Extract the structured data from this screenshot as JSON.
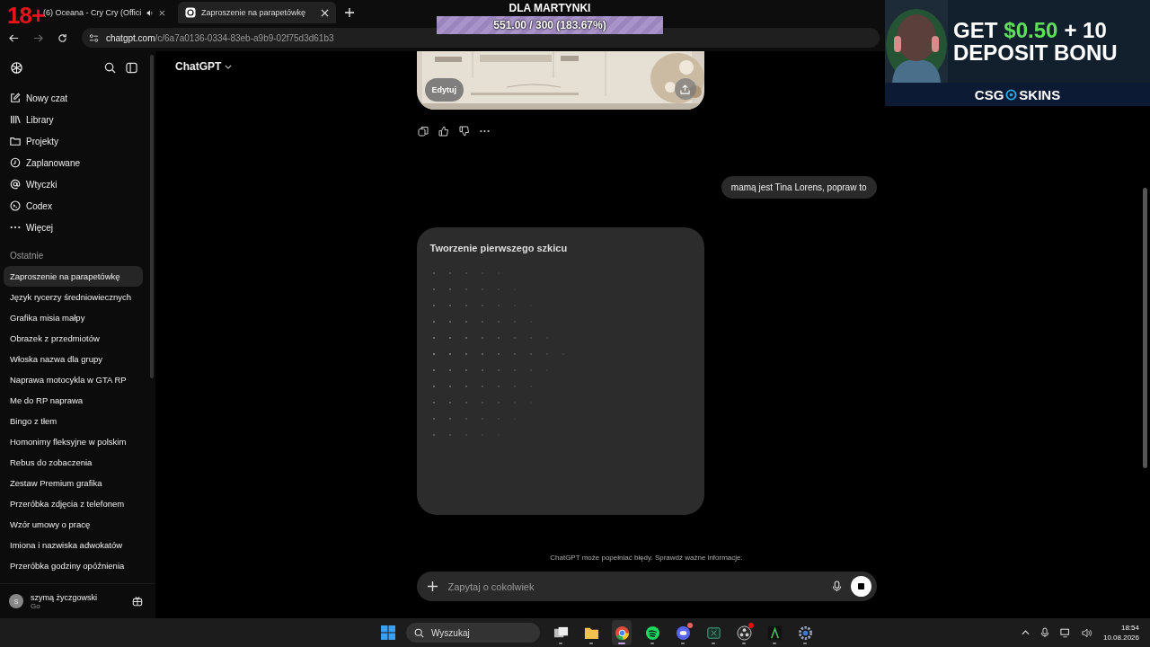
{
  "browser": {
    "tabs": [
      {
        "title": "(6) Oceana - Cry Cry (Offici",
        "selected": false,
        "audio": true
      },
      {
        "title": "Zaproszenie na parapetówkę",
        "selected": true,
        "audio": false
      }
    ],
    "address": {
      "host": "chatgpt.com",
      "path": "/c/6a7a0136-0334-83eb-a9b9-02f75d3d61b3"
    }
  },
  "overlays": {
    "age_badge": "18+",
    "goal": {
      "title": "DLA MARTYNKI",
      "reading": "551.00 / 300 (183.67%)",
      "level": 1
    },
    "ad": {
      "headline": [
        {
          "text": "GET",
          "highlight": false
        },
        {
          "text": "$0.50",
          "highlight": true
        },
        {
          "text": "+ 10",
          "highlight": false
        }
      ],
      "headline_2": "DEPOSIT BONU",
      "brand_left": "CSG",
      "brand_right": "SKINS"
    }
  },
  "sidebar": {
    "nav": [
      {
        "label": "Nowy czat",
        "kind": "compose"
      },
      {
        "label": "Library",
        "kind": "library"
      },
      {
        "label": "Projekty",
        "kind": "folder"
      },
      {
        "label": "Zaplanowane",
        "kind": "clock"
      },
      {
        "label": "Wtyczki",
        "kind": "at"
      },
      {
        "label": "Codex",
        "kind": "terminal"
      },
      {
        "label": "Więcej",
        "kind": "more"
      }
    ],
    "section_title": "Ostatnie",
    "chats": [
      {
        "title": "Zaproszenie na parapetówkę",
        "selected": true
      },
      {
        "title": "Język rycerzy średniowiecznych",
        "selected": false
      },
      {
        "title": "Grafika misia małpy",
        "selected": false
      },
      {
        "title": "Obrazek z przedmiotów",
        "selected": false
      },
      {
        "title": "Włoska nazwa dla grupy",
        "selected": false
      },
      {
        "title": "Naprawa motocykla w GTA RP",
        "selected": false
      },
      {
        "title": "Me do RP naprawa",
        "selected": false
      },
      {
        "title": "Bingo z tłem",
        "selected": false
      },
      {
        "title": "Homonimy fleksyjne w polskim",
        "selected": false
      },
      {
        "title": "Rebus do zobaczenia",
        "selected": false
      },
      {
        "title": "Zestaw Premium grafika",
        "selected": false
      },
      {
        "title": "Przeróbka zdjęcia z telefonem",
        "selected": false
      },
      {
        "title": "Wzór umowy o pracę",
        "selected": false
      },
      {
        "title": "Imiona i nazwiska adwokatów",
        "selected": false
      },
      {
        "title": "Przeróbka godziny opóźnienia",
        "selected": false
      }
    ],
    "user": {
      "initial": "S",
      "name": "szymą życzgowski",
      "plan": "Go"
    }
  },
  "chat": {
    "title": "ChatGPT",
    "image_card": {
      "kind": "picture",
      "edit_label": "Edytuj"
    },
    "user_message": "mamą jest Tina Lorens, popraw to",
    "draft": {
      "title": "Tworzenie pierwszego szkicu"
    },
    "disclaimer": "ChatGPT może popełniać błędy. Sprawdź ważne informacje.",
    "composer": {
      "placeholder": "Zapytaj o cokolwiek"
    }
  },
  "taskbar": {
    "search_placeholder": "Wyszukaj",
    "apps": [
      {
        "kind": "taskview",
        "selected": false,
        "badge": false
      },
      {
        "kind": "explorer",
        "selected": false,
        "badge": false
      },
      {
        "kind": "chrome",
        "selected": true,
        "badge": false
      },
      {
        "kind": "spotify",
        "selected": false,
        "badge": false
      },
      {
        "kind": "discord",
        "selected": false,
        "badge": true
      },
      {
        "kind": "sheet",
        "selected": false,
        "badge": false
      },
      {
        "kind": "obs",
        "selected": false,
        "badge": true
      },
      {
        "kind": "green",
        "selected": false,
        "badge": false
      },
      {
        "kind": "gear",
        "selected": false,
        "badge": false
      }
    ],
    "time": "18:54",
    "date": "10.08.2026"
  }
}
